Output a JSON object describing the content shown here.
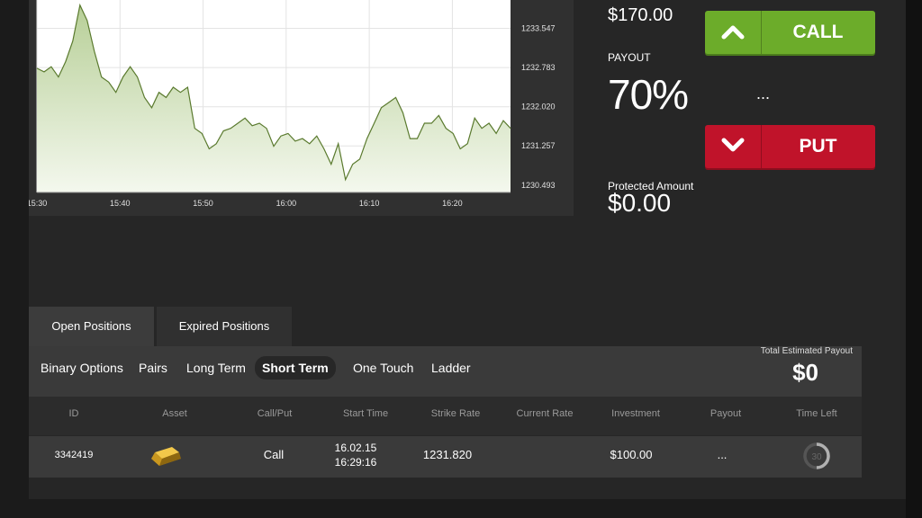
{
  "chart": {
    "y_ticks": [
      "1233.547",
      "1232.783",
      "1232.020",
      "1231.257",
      "1230.493"
    ],
    "x_ticks": [
      "15:30",
      "15:40",
      "15:50",
      "16:00",
      "16:10",
      "16:20"
    ],
    "colors": {
      "line": "#5a7a2e",
      "fill": "#b7cf97",
      "background": "#ffffff"
    }
  },
  "chart_data": {
    "type": "area",
    "xlabel": "",
    "ylabel": "",
    "x_start": "15:30",
    "x_end": "16:27",
    "ylim": [
      1230.35,
      1234.1
    ],
    "series": [
      {
        "values": [
          1232.77,
          1232.7,
          1232.8,
          1232.6,
          1232.9,
          1233.3,
          1234.0,
          1233.7,
          1233.1,
          1232.6,
          1232.5,
          1232.3,
          1232.6,
          1232.8,
          1232.6,
          1232.2,
          1232.0,
          1232.3,
          1232.2,
          1232.4,
          1232.3,
          1232.4,
          1231.6,
          1231.5,
          1231.2,
          1231.3,
          1231.55,
          1231.6,
          1231.7,
          1231.8,
          1231.65,
          1231.7,
          1231.6,
          1231.25,
          1231.45,
          1231.5,
          1231.35,
          1231.4,
          1231.3,
          1231.45,
          1231.2,
          1230.9,
          1231.3,
          1230.6,
          1230.9,
          1231.0,
          1231.4,
          1231.7,
          1232.0,
          1232.1,
          1232.2,
          1231.9,
          1231.4,
          1231.4,
          1231.7,
          1231.7,
          1231.85,
          1231.6,
          1231.5,
          1231.2,
          1231.3,
          1231.8,
          1231.6,
          1231.7,
          1231.5,
          1231.75,
          1231.6
        ]
      }
    ]
  },
  "trade": {
    "investment": "$170.00",
    "payout_label": "PAYOUT",
    "payout_value": "70%",
    "payout_amount": "...",
    "protected_label": "Protected Amount",
    "protected_value": "$0.00",
    "call_label": "CALL",
    "put_label": "PUT",
    "colors": {
      "call": "#6cac2a",
      "put": "#c0132a"
    }
  },
  "positions": {
    "tabs": [
      "Open Positions",
      "Expired Positions"
    ],
    "filters": [
      "Binary Options",
      "Pairs",
      "Long Term",
      "Short Term",
      "One Touch",
      "Ladder"
    ],
    "active_filter": "Short Term",
    "total_label": "Total Estimated Payout",
    "total_value": "$0",
    "columns": [
      "ID",
      "Asset",
      "Call/Put",
      "Start Time",
      "Strike Rate",
      "Current Rate",
      "Investment",
      "Payout",
      "Time Left"
    ],
    "rows": [
      {
        "id": "3342419",
        "asset_icon": "gold-bar-icon",
        "direction": "Call",
        "start_date": "16.02.15",
        "start_time": "16:29:16",
        "strike_rate": "1231.820",
        "current_rate": "",
        "investment": "$100.00",
        "payout": "...",
        "time_left": "30",
        "time_left_fraction": 0.5
      }
    ]
  }
}
